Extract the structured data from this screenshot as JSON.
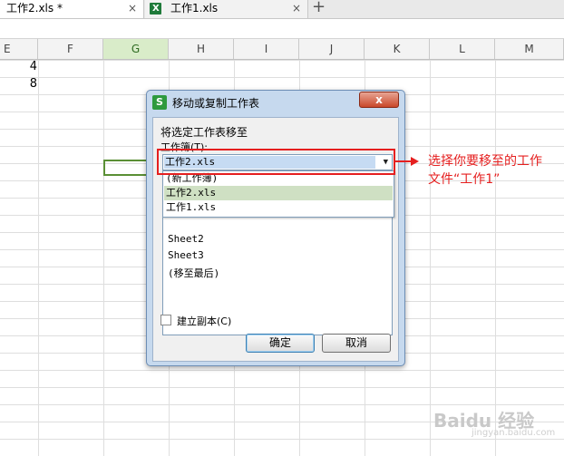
{
  "tabs": [
    {
      "label": "工作2.xls *",
      "close": "×"
    },
    {
      "label": "工作1.xls",
      "close": "×"
    }
  ],
  "new_tab_glyph": "+",
  "columns": [
    "E",
    "F",
    "G",
    "H",
    "I",
    "J",
    "K",
    "L",
    "M"
  ],
  "selected_column": "G",
  "cells": {
    "e1": "4",
    "e2": "8"
  },
  "dialog": {
    "title": "移动或复制工作表",
    "close_glyph": "x",
    "move_label": "将选定工作表移至",
    "workbook_label": "工作簿(T):",
    "workbook_selected": "工作2.xls",
    "workbook_options": [
      "(新工作簿)",
      "工作2.xls",
      "工作1.xls"
    ],
    "highlighted_option": "工作2.xls",
    "before_sheets_visible": [
      "Sheet2",
      "Sheet3",
      "(移至最后)"
    ],
    "copy_label": "建立副本(C)",
    "copy_checked": false,
    "ok_label": "确定",
    "cancel_label": "取消"
  },
  "annotation": {
    "line1": "选择你要移至的工作",
    "line2": "文件“工作1”",
    "color": "#e51f1f"
  },
  "watermark": {
    "brand": "Baidu 经验",
    "url": "jingyan.baidu.com"
  },
  "colors": {
    "accent_green": "#5a8f35",
    "dialog_frame": "#c6d9ee",
    "highlight": "#cfe0c3"
  }
}
